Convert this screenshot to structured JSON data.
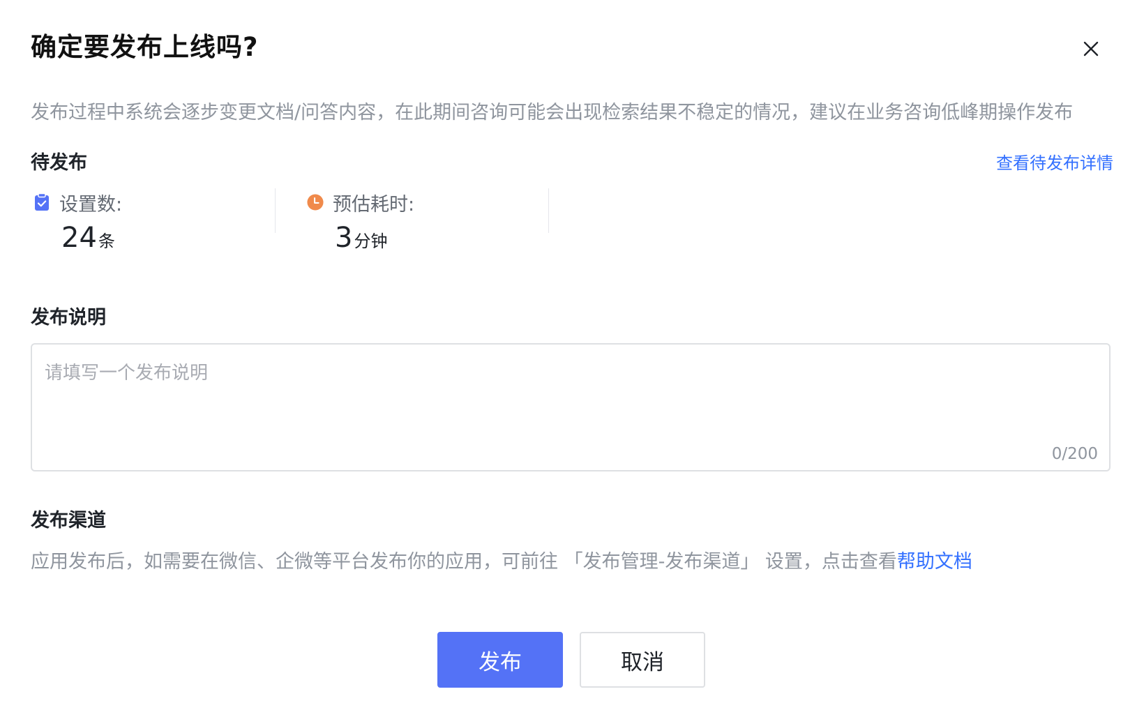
{
  "dialog": {
    "title": "确定要发布上线吗?",
    "description": "发布过程中系统会逐步变更文档/问答内容，在此期间咨询可能会出现检索结果不稳定的情况，建议在业务咨询低峰期操作发布"
  },
  "pending": {
    "title": "待发布",
    "detail_link": "查看待发布详情",
    "count": {
      "label": "设置数:",
      "value": "24",
      "unit": "条",
      "icon": "clipboard-check-icon",
      "icon_color": "#5472f6"
    },
    "time": {
      "label": "预估耗时:",
      "value": "3",
      "unit": "分钟",
      "icon": "clock-icon",
      "icon_color": "#f08a4b"
    }
  },
  "notes": {
    "title": "发布说明",
    "placeholder": "请填写一个发布说明",
    "value": "",
    "char_count": "0/200"
  },
  "channel": {
    "title": "发布渠道",
    "description": "应用发布后，如需要在微信、企微等平台发布你的应用，可前往 「发布管理-发布渠道」 设置，点击查看",
    "help_link": "帮助文档"
  },
  "actions": {
    "publish_label": "发布",
    "cancel_label": "取消"
  },
  "colors": {
    "primary": "#5472f6",
    "link": "#3370ff",
    "muted_text": "#8f959e"
  }
}
